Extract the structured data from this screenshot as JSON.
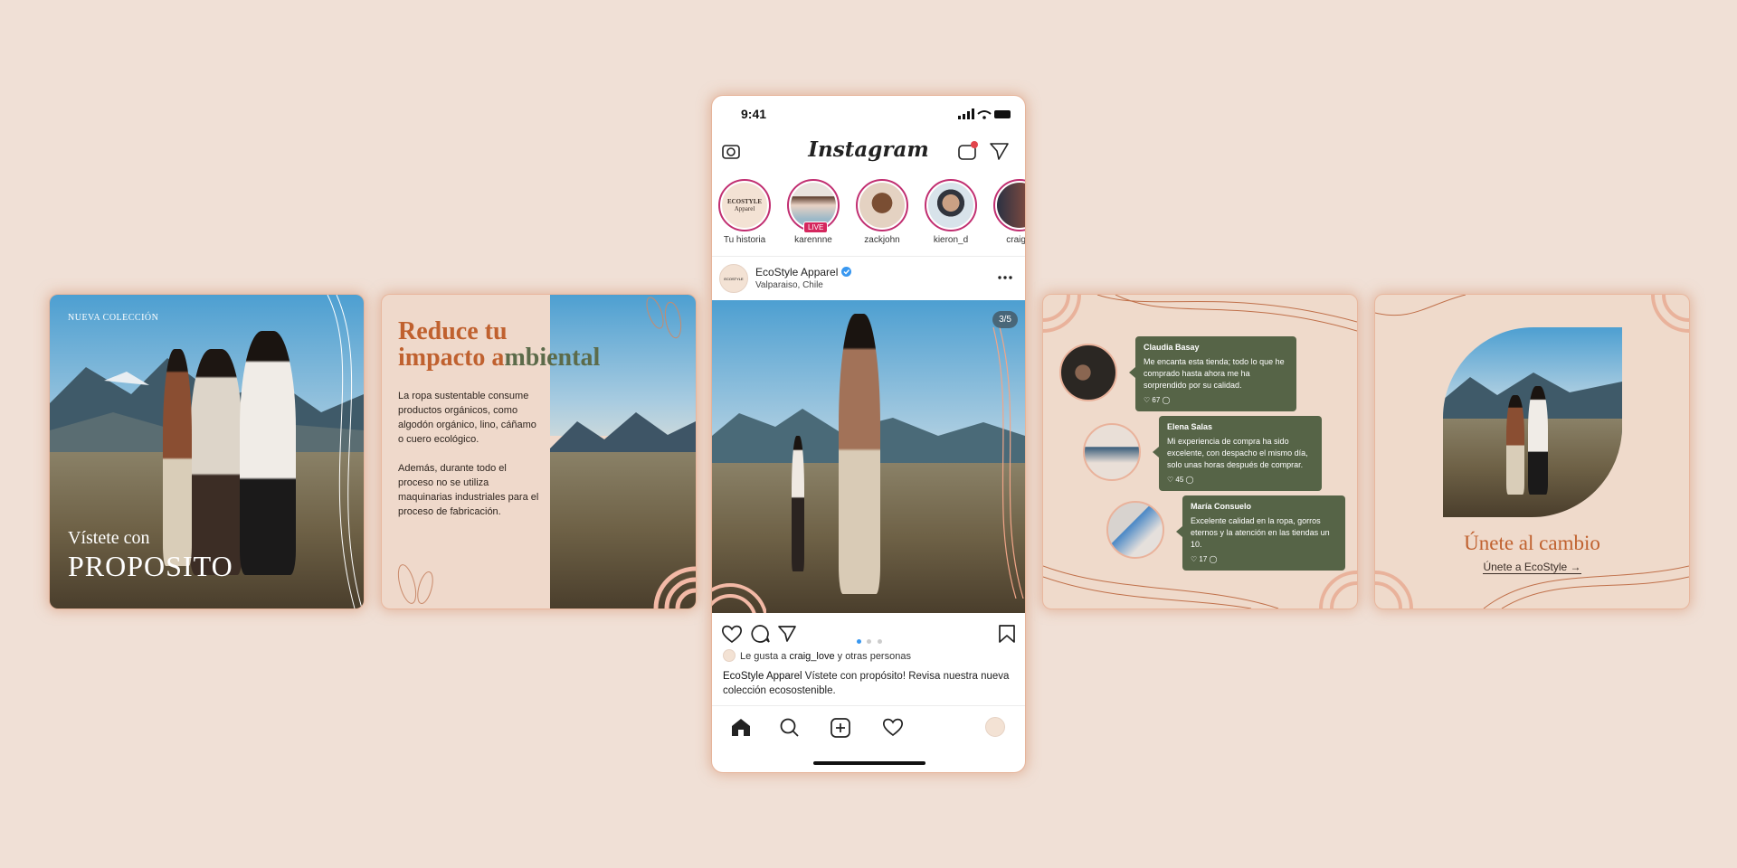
{
  "card1": {
    "small_label": "NUEVA COLECCIÓN",
    "title_line1": "Vístete con",
    "title_line2": "PROPOSITO"
  },
  "card2": {
    "title_part1": "Reduce tu",
    "title_part2": "impacto a",
    "title_part3": "mbiental",
    "paragraph1": "La ropa sustentable consume productos orgánicos, como algodón orgánico, lino, cáñamo o cuero ecológico.",
    "paragraph2": "Además, durante todo el proceso no se utiliza maquinarias industriales para el proceso de fabricación."
  },
  "phone": {
    "status_time": "9:41",
    "app_logo": "Instagram",
    "notification_badge": "",
    "stories": [
      {
        "name": "Tu historia",
        "avatar_text_line1": "ECOSTYLE",
        "avatar_text_line2": "Apparel"
      },
      {
        "name": "karennne",
        "badge": "LIVE"
      },
      {
        "name": "zackjohn"
      },
      {
        "name": "kieron_d"
      },
      {
        "name": "craig_l"
      }
    ],
    "post": {
      "account": "EcoStyle Apparel",
      "location": "Valparaiso, Chile",
      "counter": "3/5",
      "likes_prefix": "Le gusta a ",
      "likes_user": "craig_love",
      "likes_suffix": " y otras personas",
      "caption_account": "EcoStyle Apparel",
      "caption_text": " Vístete con propósito! Revisa nuestra nueva colección ecosostenible."
    },
    "icons": [
      "camera-icon",
      "igtv-icon",
      "direct-icon",
      "more-icon",
      "heart-icon",
      "comment-icon",
      "share-icon",
      "bookmark-icon",
      "home-icon",
      "search-icon",
      "add-icon",
      "activity-icon",
      "profile-icon"
    ]
  },
  "card4": {
    "reviews": [
      {
        "name": "Claudia Basay",
        "text": "Me encanta esta tienda; todo lo que he comprado hasta ahora me ha sorprendido por su calidad.",
        "likes": "67"
      },
      {
        "name": "Elena Salas",
        "text": "Mi experiencia de compra ha sido excelente, con despacho el mismo día, solo unas horas después de comprar.",
        "likes": "45"
      },
      {
        "name": "María Consuelo",
        "text": "Excelente calidad en la ropa, gorros eternos y la atención en las tiendas un 10.",
        "likes": "17"
      }
    ]
  },
  "card5": {
    "cta_title": "Únete al cambio",
    "cta_link": "Únete a EcoStyle →"
  },
  "colors": {
    "background": "#f0e0d6",
    "accent_orange": "#c0612f",
    "olive": "#566447",
    "ig_live": "#d5275e"
  }
}
